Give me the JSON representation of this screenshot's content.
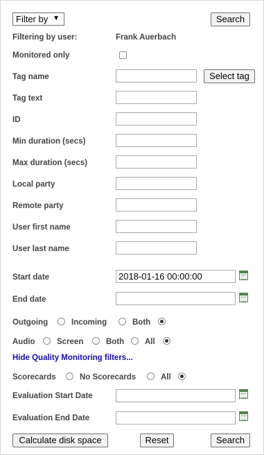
{
  "top": {
    "filter_select": "Filter by",
    "filter_arrow": "▼",
    "search_button": "Search"
  },
  "user": {
    "label": "Filtering by user:",
    "value": "Frank Auerbach"
  },
  "monitored": {
    "label": "Monitored only",
    "checked": false
  },
  "fields": {
    "tag_name": {
      "label": "Tag name",
      "value": ""
    },
    "select_tag_button": "Select tag",
    "tag_text": {
      "label": "Tag text",
      "value": ""
    },
    "id": {
      "label": "ID",
      "value": ""
    },
    "min_duration": {
      "label": "Min duration (secs)",
      "value": ""
    },
    "max_duration": {
      "label": "Max duration (secs)",
      "value": ""
    },
    "local_party": {
      "label": "Local party",
      "value": ""
    },
    "remote_party": {
      "label": "Remote party",
      "value": ""
    },
    "user_first_name": {
      "label": "User first name",
      "value": ""
    },
    "user_last_name": {
      "label": "User last name",
      "value": ""
    }
  },
  "dates": {
    "start": {
      "label": "Start date",
      "value": "2018-01-16 00:00:00"
    },
    "end": {
      "label": "End date",
      "value": ""
    }
  },
  "direction": {
    "options": [
      "Outgoing",
      "Incoming",
      "Both"
    ],
    "selected": "Both"
  },
  "media": {
    "options": [
      "Audio",
      "Screen",
      "Both",
      "All"
    ],
    "selected": "All"
  },
  "quality_link": "Hide Quality Monitoring filters...",
  "scorecards": {
    "options": [
      "Scorecards",
      "No Scorecards",
      "All"
    ],
    "selected": "All"
  },
  "evaluation": {
    "start": {
      "label": "Evaluation Start Date",
      "value": ""
    },
    "end": {
      "label": "Evaluation End Date",
      "value": ""
    }
  },
  "bottom": {
    "calc_button": "Calculate disk space",
    "reset_button": "Reset",
    "search_button": "Search"
  },
  "icons": {
    "calendar": "calendar-icon"
  }
}
